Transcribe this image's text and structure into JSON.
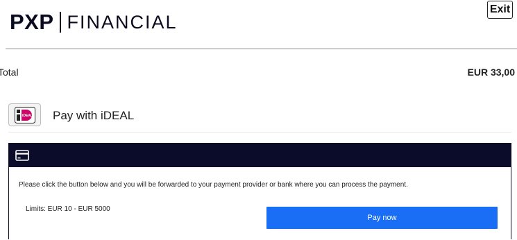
{
  "header": {
    "logo_mark": "PXP",
    "logo_text": "FINANCIAL",
    "exit_label": "Exit"
  },
  "summary": {
    "total_label": "Total",
    "total_amount": "EUR 33,00"
  },
  "payment_method": {
    "label": "Pay with iDEAL",
    "logo_text": "iDEAL"
  },
  "panel": {
    "icon": "credit-card-icon",
    "instruction": "Please click the button below and you will be forwarded to your payment provider or bank where you can process the payment.",
    "limits": "Limits: EUR 10 - EUR 5000",
    "pay_button_label": "Pay now"
  },
  "colors": {
    "brand_dark": "#0b0b2a",
    "pay_button": "#1a6ef5",
    "ideal_pink": "#cc0066"
  }
}
